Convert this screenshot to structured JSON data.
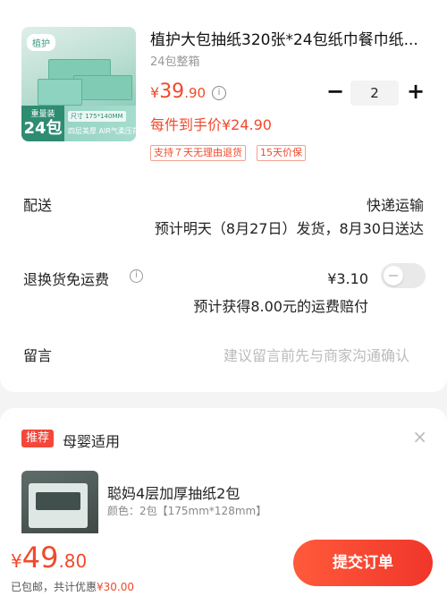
{
  "product": {
    "title": "植护大包抽纸320张*24包纸巾餐巾纸...",
    "sku": "24包整箱",
    "price_currency": "¥",
    "price_int": "39",
    "price_dec": ".90",
    "info_icon_glyph": "i",
    "quantity": "2",
    "minus_glyph": "−",
    "plus_glyph": "+",
    "unit_price_text": "每件到手价¥24.90",
    "tags": [
      "支持７天无理由退货",
      "15天价保"
    ],
    "image": {
      "brand_tag": "植护",
      "size_label": "尺寸 175*140MM",
      "count_small": "重量装",
      "count_big": "24包",
      "feature_text": "四层美厚 AIR气柔压花"
    }
  },
  "delivery": {
    "label": "配送",
    "method": "快递运输",
    "estimate": "预计明天（8月27日）发货，8月30日送达"
  },
  "return_shipping": {
    "label": "退换货免运费",
    "help_glyph": "i",
    "price": "¥3.10",
    "note": "预计获得8.00元的运费赔付",
    "enabled": false
  },
  "message": {
    "label": "留言",
    "placeholder": "建议留言前先与商家沟通确认"
  },
  "recommend": {
    "badge": "推荐",
    "title": "母婴适用",
    "close_glyph": "×",
    "item_name": "聪妈4层加厚抽纸2包",
    "item_spec": "颜色：2包【175mm*128mm】"
  },
  "footer": {
    "currency": "¥",
    "total_int": "49",
    "total_dec": ".80",
    "note_prefix": "已包邮，共计优惠",
    "discount": "¥30.00",
    "submit_label": "提交订单"
  },
  "colors": {
    "accent": "#f04a2c",
    "submit": "#f0362a",
    "toggle_off": "#e9e9e9"
  }
}
